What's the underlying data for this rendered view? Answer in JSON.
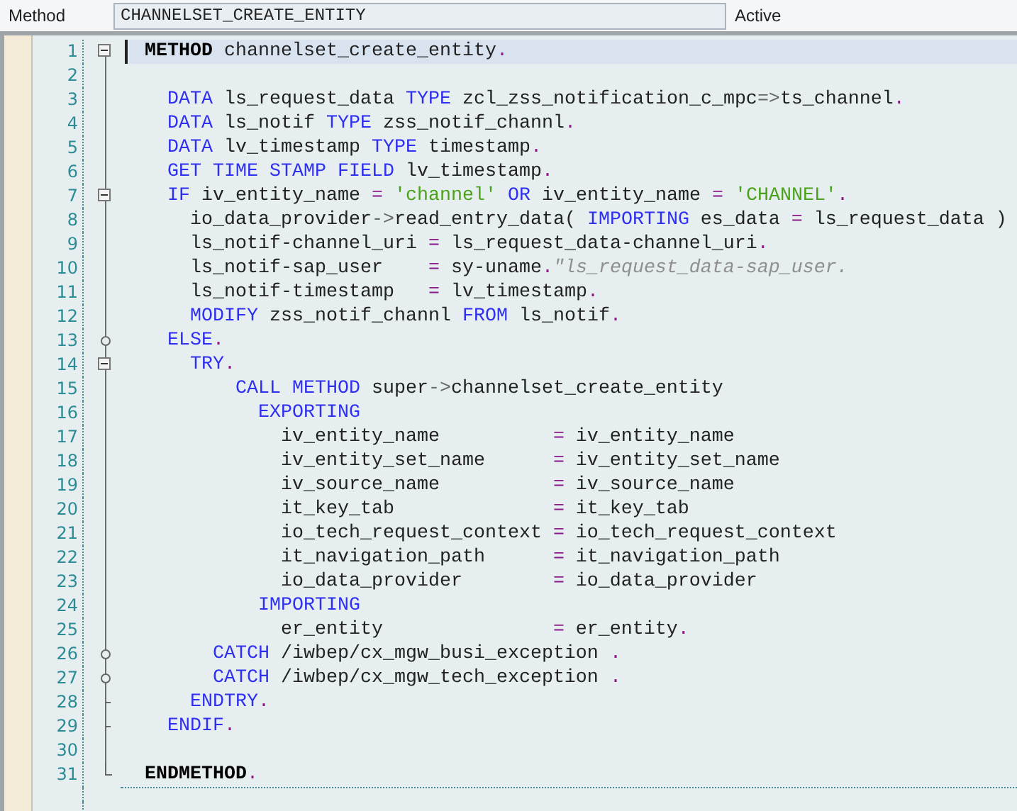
{
  "header": {
    "label": "Method",
    "value": "CHANNELSET_CREATE_ENTITY",
    "status": "Active"
  },
  "lines": [
    {
      "number": "1",
      "current": true,
      "kind": "fold-start",
      "tokens": [
        {
          "kind": "bold",
          "text": "METHOD"
        },
        {
          "kind": "id",
          "text": " channelset_create_entity"
        },
        {
          "kind": "op",
          "text": "."
        }
      ]
    },
    {
      "number": "2",
      "current": false
    },
    {
      "number": "3",
      "current": false,
      "tokens": [
        {
          "kind": "kw",
          "text": "  DATA"
        },
        {
          "kind": "id",
          "text": " ls_request_data "
        },
        {
          "kind": "kw",
          "text": "TYPE"
        },
        {
          "kind": "id",
          "text": " zcl_zss_notification_c_mpc"
        },
        {
          "kind": "arrow",
          "text": "=>"
        },
        {
          "kind": "id",
          "text": "ts_channel"
        },
        {
          "kind": "op",
          "text": "."
        }
      ]
    },
    {
      "number": "4",
      "current": false,
      "tokens": [
        {
          "kind": "kw",
          "text": "  DATA"
        },
        {
          "kind": "id",
          "text": " ls_notif "
        },
        {
          "kind": "kw",
          "text": "TYPE"
        },
        {
          "kind": "id",
          "text": " zss_notif_channl"
        },
        {
          "kind": "op",
          "text": "."
        }
      ]
    },
    {
      "number": "5",
      "current": false,
      "tokens": [
        {
          "kind": "kw",
          "text": "  DATA"
        },
        {
          "kind": "id",
          "text": " lv_timestamp "
        },
        {
          "kind": "kw",
          "text": "TYPE"
        },
        {
          "kind": "id",
          "text": " timestamp"
        },
        {
          "kind": "op",
          "text": "."
        }
      ]
    },
    {
      "number": "6",
      "current": false,
      "tokens": [
        {
          "kind": "kw",
          "text": "  GET TIME STAMP FIELD"
        },
        {
          "kind": "id",
          "text": " lv_timestamp"
        },
        {
          "kind": "op",
          "text": "."
        }
      ]
    },
    {
      "number": "7",
      "current": false,
      "kind": "fold-start",
      "tokens": [
        {
          "kind": "kw",
          "text": "  IF"
        },
        {
          "kind": "id",
          "text": " iv_entity_name "
        },
        {
          "kind": "op",
          "text": "="
        },
        {
          "kind": "str",
          "text": " 'channel' "
        },
        {
          "kind": "kw",
          "text": "OR"
        },
        {
          "kind": "id",
          "text": " iv_entity_name "
        },
        {
          "kind": "op",
          "text": "="
        },
        {
          "kind": "str",
          "text": " 'CHANNEL'"
        },
        {
          "kind": "op",
          "text": "."
        }
      ]
    },
    {
      "number": "8",
      "current": false,
      "tokens": [
        {
          "kind": "id",
          "text": "    io_data_provider"
        },
        {
          "kind": "arrow",
          "text": "->"
        },
        {
          "kind": "id",
          "text": "read_entry_data( "
        },
        {
          "kind": "kw",
          "text": "IMPORTING"
        },
        {
          "kind": "id",
          "text": " es_data "
        },
        {
          "kind": "op",
          "text": "="
        },
        {
          "kind": "id",
          "text": " ls_request_data )"
        }
      ]
    },
    {
      "number": "9",
      "current": false,
      "tokens": [
        {
          "kind": "id",
          "text": "    ls_notif-channel_uri "
        },
        {
          "kind": "op",
          "text": "="
        },
        {
          "kind": "id",
          "text": " ls_request_data-channel_uri"
        },
        {
          "kind": "op",
          "text": "."
        }
      ]
    },
    {
      "number": "10",
      "current": false,
      "tokens": [
        {
          "kind": "id",
          "text": "    ls_notif-sap_user    "
        },
        {
          "kind": "op",
          "text": "="
        },
        {
          "kind": "id",
          "text": " sy-uname"
        },
        {
          "kind": "op",
          "text": "."
        },
        {
          "kind": "cmt",
          "text": "\"ls_request_data-sap_user."
        }
      ]
    },
    {
      "number": "11",
      "current": false,
      "tokens": [
        {
          "kind": "id",
          "text": "    ls_notif-timestamp   "
        },
        {
          "kind": "op",
          "text": "="
        },
        {
          "kind": "id",
          "text": " lv_timestamp"
        },
        {
          "kind": "op",
          "text": "."
        }
      ]
    },
    {
      "number": "12",
      "current": false,
      "tokens": [
        {
          "kind": "kw",
          "text": "    MODIFY"
        },
        {
          "kind": "id",
          "text": " zss_notif_channl "
        },
        {
          "kind": "kw",
          "text": "FROM"
        },
        {
          "kind": "id",
          "text": " ls_notif"
        },
        {
          "kind": "op",
          "text": "."
        }
      ]
    },
    {
      "number": "13",
      "current": false,
      "kind": "fold-branch",
      "tokens": [
        {
          "kind": "kw",
          "text": "  ELSE"
        },
        {
          "kind": "op",
          "text": "."
        }
      ]
    },
    {
      "number": "14",
      "current": false,
      "kind": "fold-start",
      "tokens": [
        {
          "kind": "kw",
          "text": "    TRY"
        },
        {
          "kind": "op",
          "text": "."
        }
      ]
    },
    {
      "number": "15",
      "current": false,
      "tokens": [
        {
          "kind": "kw",
          "text": "        CALL METHOD"
        },
        {
          "kind": "id",
          "text": " super"
        },
        {
          "kind": "arrow",
          "text": "->"
        },
        {
          "kind": "id",
          "text": "channelset_create_entity"
        }
      ]
    },
    {
      "number": "16",
      "current": false,
      "tokens": [
        {
          "kind": "kw",
          "text": "          EXPORTING"
        }
      ]
    },
    {
      "number": "17",
      "current": false,
      "tokens": [
        {
          "kind": "id",
          "text": "            iv_entity_name          "
        },
        {
          "kind": "op",
          "text": "="
        },
        {
          "kind": "id",
          "text": " iv_entity_name"
        }
      ]
    },
    {
      "number": "18",
      "current": false,
      "tokens": [
        {
          "kind": "id",
          "text": "            iv_entity_set_name      "
        },
        {
          "kind": "op",
          "text": "="
        },
        {
          "kind": "id",
          "text": " iv_entity_set_name"
        }
      ]
    },
    {
      "number": "19",
      "current": false,
      "tokens": [
        {
          "kind": "id",
          "text": "            iv_source_name          "
        },
        {
          "kind": "op",
          "text": "="
        },
        {
          "kind": "id",
          "text": " iv_source_name"
        }
      ]
    },
    {
      "number": "20",
      "current": false,
      "tokens": [
        {
          "kind": "id",
          "text": "            it_key_tab              "
        },
        {
          "kind": "op",
          "text": "="
        },
        {
          "kind": "id",
          "text": " it_key_tab"
        }
      ]
    },
    {
      "number": "21",
      "current": false,
      "tokens": [
        {
          "kind": "id",
          "text": "            io_tech_request_context "
        },
        {
          "kind": "op",
          "text": "="
        },
        {
          "kind": "id",
          "text": " io_tech_request_context"
        }
      ]
    },
    {
      "number": "22",
      "current": false,
      "tokens": [
        {
          "kind": "id",
          "text": "            it_navigation_path      "
        },
        {
          "kind": "op",
          "text": "="
        },
        {
          "kind": "id",
          "text": " it_navigation_path"
        }
      ]
    },
    {
      "number": "23",
      "current": false,
      "tokens": [
        {
          "kind": "id",
          "text": "            io_data_provider        "
        },
        {
          "kind": "op",
          "text": "="
        },
        {
          "kind": "id",
          "text": " io_data_provider"
        }
      ]
    },
    {
      "number": "24",
      "current": false,
      "tokens": [
        {
          "kind": "kw",
          "text": "          IMPORTING"
        }
      ]
    },
    {
      "number": "25",
      "current": false,
      "tokens": [
        {
          "kind": "id",
          "text": "            er_entity               "
        },
        {
          "kind": "op",
          "text": "="
        },
        {
          "kind": "id",
          "text": " er_entity"
        },
        {
          "kind": "op",
          "text": "."
        }
      ]
    },
    {
      "number": "26",
      "current": false,
      "kind": "fold-branch",
      "tokens": [
        {
          "kind": "kw",
          "text": "      CATCH"
        },
        {
          "kind": "id",
          "text": " /iwbep/cx_mgw_busi_exception "
        },
        {
          "kind": "op",
          "text": "."
        }
      ]
    },
    {
      "number": "27",
      "current": false,
      "kind": "fold-branch",
      "tokens": [
        {
          "kind": "kw",
          "text": "      CATCH"
        },
        {
          "kind": "id",
          "text": " /iwbep/cx_mgw_tech_exception "
        },
        {
          "kind": "op",
          "text": "."
        }
      ]
    },
    {
      "number": "28",
      "current": false,
      "kind": "fold-close",
      "tokens": [
        {
          "kind": "kw",
          "text": "    ENDTRY"
        },
        {
          "kind": "op",
          "text": "."
        }
      ]
    },
    {
      "number": "29",
      "current": false,
      "kind": "fold-close",
      "tokens": [
        {
          "kind": "kw",
          "text": "  ENDIF"
        },
        {
          "kind": "op",
          "text": "."
        }
      ]
    },
    {
      "number": "30",
      "current": false
    },
    {
      "number": "31",
      "current": false,
      "kind": "fold-last",
      "tokens": [
        {
          "kind": "bold",
          "text": "ENDMETHOD"
        },
        {
          "kind": "op",
          "text": "."
        }
      ]
    }
  ]
}
